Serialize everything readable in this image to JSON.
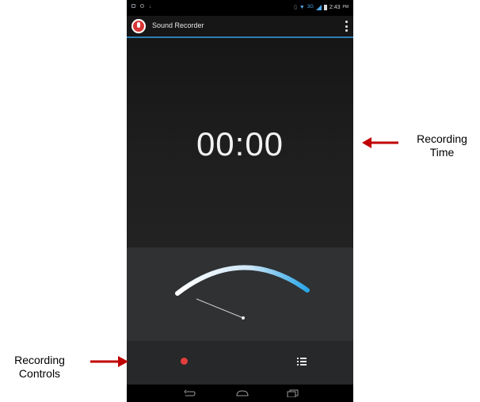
{
  "status_bar": {
    "network": "3G",
    "time": "2:43",
    "ampm": "PM"
  },
  "app_bar": {
    "title": "Sound Recorder"
  },
  "main": {
    "timer": "00:00"
  },
  "annotations": {
    "time_label_line1": "Recording",
    "time_label_line2": "Time",
    "controls_label_line1": "Recording",
    "controls_label_line2": "Controls"
  },
  "colors": {
    "accent": "#2c7fb3",
    "record": "#e23d3d",
    "arrow": "#c00000"
  },
  "icons": {
    "app": "microphone-icon",
    "overflow": "overflow-menu-icon",
    "record": "record-icon",
    "list": "list-icon",
    "back": "back-icon",
    "home": "home-icon",
    "recents": "recents-icon"
  }
}
